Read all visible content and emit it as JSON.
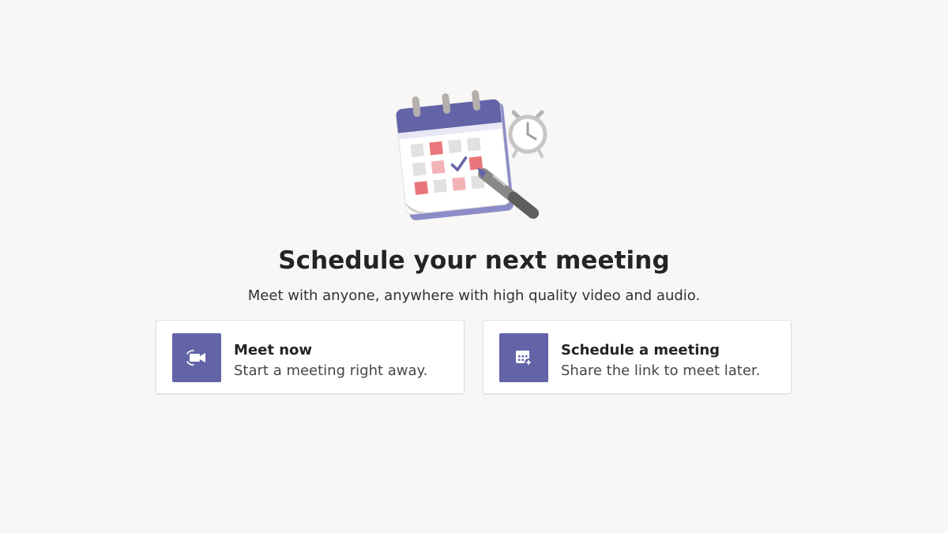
{
  "hero": {
    "illustration": "calendar-with-clock-and-pen-illustration",
    "title": "Schedule your next meeting",
    "subtitle": "Meet with anyone, anywhere with high quality video and audio."
  },
  "actions": [
    {
      "title": "Meet now",
      "description": "Start a meeting right away.",
      "icon": "video-camera-icon"
    },
    {
      "title": "Schedule a meeting",
      "description": "Share the link to meet later.",
      "icon": "calendar-add-icon"
    }
  ],
  "colors": {
    "background": "#f8f7f6",
    "accent": "#6264a7",
    "card": "#ffffff",
    "calendar_red": "#e8767b",
    "calendar_pink": "#f2b3b7"
  }
}
